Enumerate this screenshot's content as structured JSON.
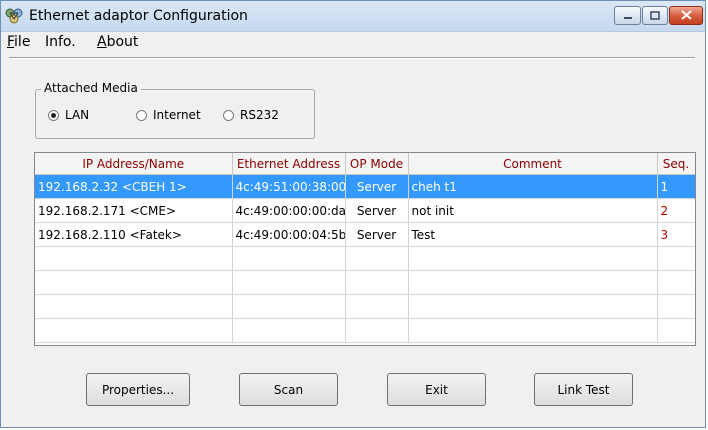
{
  "window": {
    "title": "Ethernet adaptor Configuration"
  },
  "menu": [
    {
      "key": "F",
      "rest": "ile"
    },
    {
      "key": "",
      "rest": "Info."
    },
    {
      "key": "A",
      "rest": "bout"
    }
  ],
  "media": {
    "legend": "Attached Media",
    "options": [
      "LAN",
      "Internet",
      "RS232"
    ],
    "selected": "LAN"
  },
  "table": {
    "headers": [
      "IP Address/Name",
      "Ethernet Address",
      "OP Mode",
      "Comment",
      "Seq."
    ],
    "rows": [
      [
        "192.168.2.32 <CBEH 1>",
        "4c:49:51:00:38:00",
        "Server",
        "cheh t1",
        "1"
      ],
      [
        "192.168.2.171 <CME>",
        "4c:49:00:00:00:da",
        "Server",
        "not init",
        "2"
      ],
      [
        "192.168.2.110 <Fatek>",
        "4c:49:00:00:04:5b",
        "Server",
        "Test",
        "3"
      ]
    ],
    "selected_row": 0
  },
  "buttons": {
    "properties": "Properties...",
    "scan": "Scan",
    "exit": "Exit",
    "link_test": "Link Test"
  },
  "colors": {
    "selection": "#3399ff",
    "header_text": "#8b0000",
    "seq_text": "#b00000"
  },
  "icons": {
    "app": "network-adapter-icon",
    "minimize": "minimize-icon",
    "maximize": "maximize-icon",
    "close": "close-icon"
  }
}
